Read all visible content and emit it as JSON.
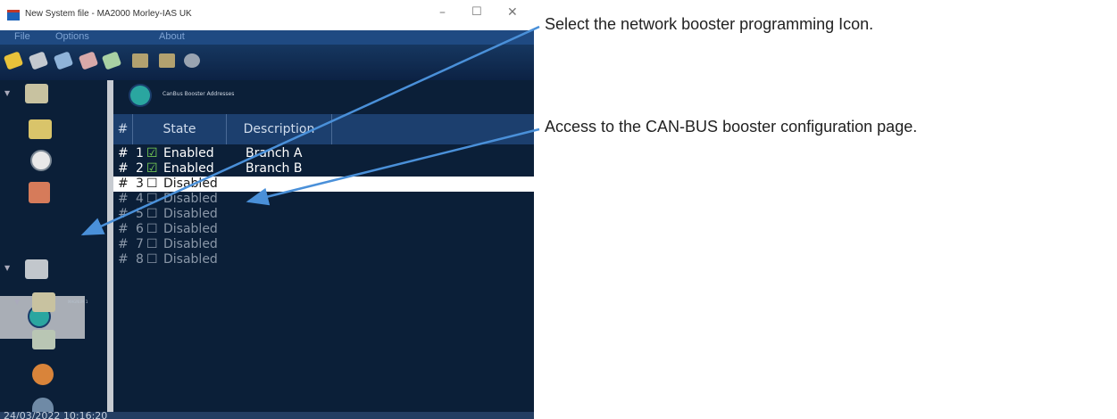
{
  "window": {
    "title": "New System file - MA2000 Morley-IAS UK",
    "minimize_glyph": "–",
    "maximize_glyph": "☐",
    "close_glyph": "✕"
  },
  "menu": {
    "items": [
      {
        "label": "File"
      },
      {
        "label": "Options"
      },
      {
        "label": "About"
      }
    ]
  },
  "toolbar": {
    "icons": [
      "open-file-icon",
      "save-file-icon",
      "export-icon",
      "print-icon",
      "send-icon",
      "upload-panel-icon",
      "download-panel-icon",
      "help-icon"
    ]
  },
  "sidebar": {
    "child_label": "MAGNUM 1",
    "items": [
      "panel-icon",
      "zone-icon",
      "module-icon",
      "loop-icon",
      "network-booster-icon",
      "group-icon",
      "magnum-icon",
      "display-icon",
      "clip-icon",
      "scroll-more-icon"
    ]
  },
  "content": {
    "page_title": "CanBus Booster Addresses",
    "columns": {
      "num": "#",
      "state": "State",
      "description": "Description"
    },
    "rows": [
      {
        "hash": "#",
        "num": "1",
        "checked": "☑",
        "state": "Enabled",
        "description": "Branch A",
        "enabled": true
      },
      {
        "hash": "#",
        "num": "2",
        "checked": "☑",
        "state": "Enabled",
        "description": "Branch B",
        "enabled": true
      },
      {
        "hash": "#",
        "num": "3",
        "checked": "☐",
        "state": "Disabled",
        "description": "",
        "enabled": false,
        "selected": true
      },
      {
        "hash": "#",
        "num": "4",
        "checked": "☐",
        "state": "Disabled",
        "description": "",
        "enabled": false
      },
      {
        "hash": "#",
        "num": "5",
        "checked": "☐",
        "state": "Disabled",
        "description": "",
        "enabled": false
      },
      {
        "hash": "#",
        "num": "6",
        "checked": "☐",
        "state": "Disabled",
        "description": "",
        "enabled": false
      },
      {
        "hash": "#",
        "num": "7",
        "checked": "☐",
        "state": "Disabled",
        "description": "",
        "enabled": false
      },
      {
        "hash": "#",
        "num": "8",
        "checked": "☐",
        "state": "Disabled",
        "description": "",
        "enabled": false
      }
    ]
  },
  "status": {
    "datetime": "24/03/2022 10:16:20"
  },
  "annotations": {
    "select_icon": "Select the network booster programming Icon.",
    "access_page": "Access to the CAN-BUS booster configuration page."
  },
  "colors": {
    "window_bg": "#0b1f38",
    "header_bg": "#1c3f6e",
    "enabled_text": "#ffffff",
    "disabled_text": "#8a97a8",
    "selected_row": "#ffffff",
    "arrow": "#4a90d9"
  }
}
